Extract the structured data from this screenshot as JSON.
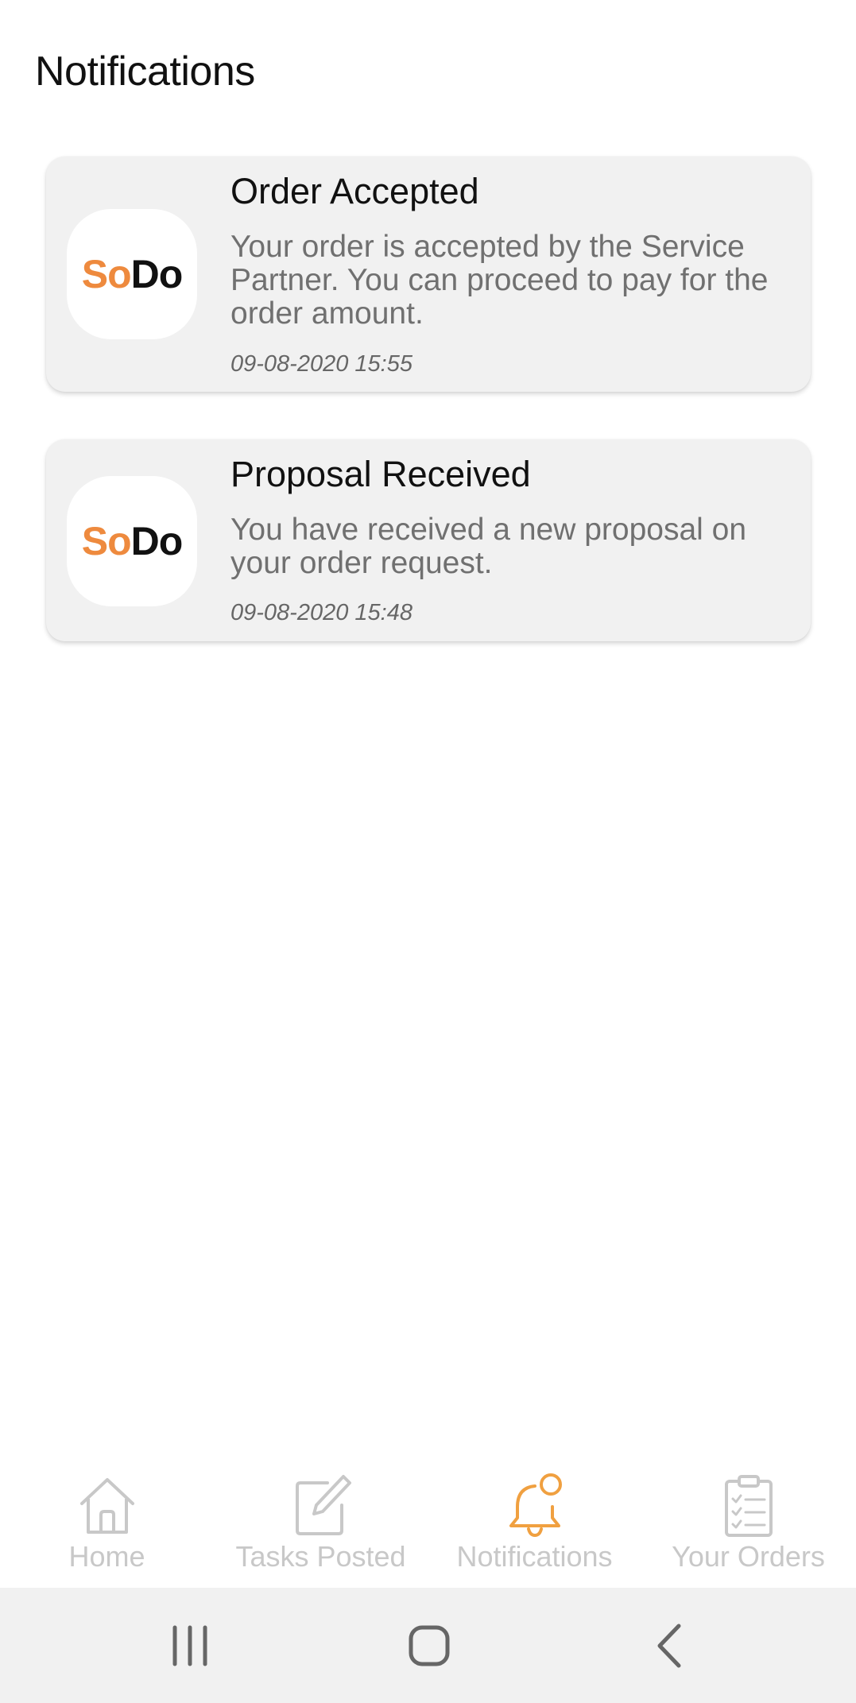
{
  "header": {
    "title": "Notifications"
  },
  "brand": {
    "logo_part1": "So",
    "logo_part2": "Do",
    "accent_color": "#ee8a3e"
  },
  "notifications": [
    {
      "title": "Order Accepted",
      "body": "Your order is accepted by the Service Partner. You can proceed to pay for the order amount.",
      "timestamp": "09-08-2020 15:55"
    },
    {
      "title": "Proposal Received",
      "body": "You have received a new proposal on your order request.",
      "timestamp": "09-08-2020 15:48"
    }
  ],
  "bottom_nav": {
    "items": [
      {
        "label": "Home",
        "icon": "home-icon",
        "active": false
      },
      {
        "label": "Tasks Posted",
        "icon": "edit-icon",
        "active": false
      },
      {
        "label": "Notifications",
        "icon": "bell-icon",
        "active": true
      },
      {
        "label": "Your Orders",
        "icon": "clipboard-icon",
        "active": false
      }
    ],
    "active_color": "#f0a040",
    "inactive_color": "#c8c8c8"
  },
  "system_nav": {
    "buttons": [
      "recents-icon",
      "home-circle-icon",
      "back-icon"
    ]
  }
}
